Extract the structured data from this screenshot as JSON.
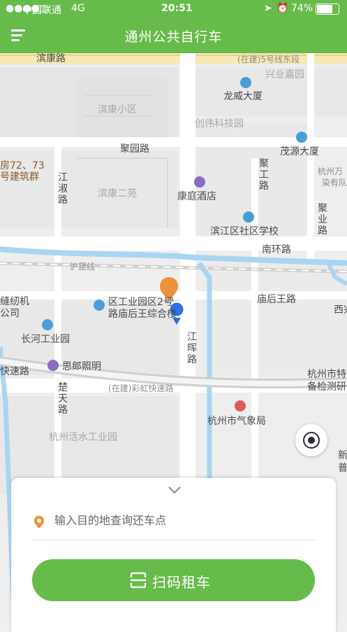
{
  "status_bar": {
    "carrier": "中国联通",
    "network": "4G",
    "time": "20:51",
    "battery": "74%"
  },
  "nav": {
    "title": "通州公共自行车"
  },
  "map": {
    "labels": {
      "binkang_road": "滨康路",
      "line5": "(在建)5号线东段",
      "xingye": "兴业嘉园",
      "longwei": "龙威大厦",
      "binkang_xiaoqu": "滨康小区",
      "chuangwei": "创伟科技园",
      "maoyuan": "茂源大厦",
      "hangzhou_wan": "杭州万",
      "ranyou": "染有队",
      "juyuan": "聚园路",
      "building1": "房72、73",
      "building2": "号建筑群",
      "jianghuai": "江淑路",
      "binkang_eryuan": "滨康二苑",
      "kangting": "康庭酒店",
      "jugong": "聚工路",
      "juye": "聚业路",
      "school": "滨江区社区学校",
      "nanhuan": "南环路",
      "hukun": "沪昆线",
      "fengren1": "缝纫机",
      "fengren2": "公司",
      "gongye1": "区工业园区2号",
      "gongye2": "路庙后王综合楼",
      "miaohouwang": "庙后王路",
      "xi": "西兴",
      "changhe": "长河工业园",
      "jianghui": "江晖路",
      "silang": "思郎照明",
      "kuaisu": "快速路",
      "caihong": "(在建)彩虹快速路",
      "tehang1": "杭州市特",
      "tehang2": "备检测研",
      "chutian": "楚天路",
      "qixiang": "杭州市气象局",
      "huoshui": "杭州活水工业园",
      "xin": "新",
      "pu": "普"
    }
  },
  "panel": {
    "placeholder": "输入目的地查询还车点",
    "scan_label": "扫码租车"
  }
}
